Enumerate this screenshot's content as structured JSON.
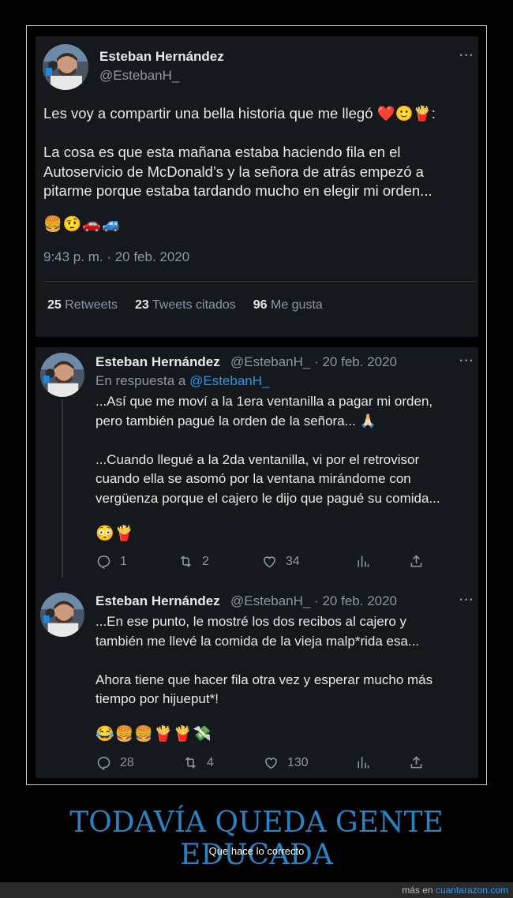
{
  "tweet1": {
    "author_name": "Esteban Hernández",
    "author_handle": "@EstebanH_",
    "more": "···",
    "text": "Les voy a compartir una bella historia que me llegó ❤️🙂🍟:\n\nLa cosa es que esta mañana estaba haciendo fila en el\nAutoservicio de McDonald’s y la señora de atrás empezó a\npitarme porque estaba tardando mucho en elegir mi orden...",
    "emojis": "🍔🤨🚗🚙",
    "timestamp": "9:43 p. m. · 20 feb. 2020",
    "retweets_count": "25",
    "retweets_label": "Retweets",
    "quotes_count": "23",
    "quotes_label": "Tweets citados",
    "likes_count": "96",
    "likes_label": "Me gusta"
  },
  "tweet2": {
    "author_name": "Esteban Hernández",
    "meta": "@EstebanH_ · 20 feb. 2020",
    "more": "···",
    "reply_prefix": "En respuesta a",
    "reply_mention": "@EstebanH_",
    "text": "...Así que me moví a la 1era ventanilla a pagar mi orden,\npero también pagué la orden de la señora... 🙏🏻\n\n...Cuando llegué a la 2da ventanilla, vi por el retrovisor\ncuando ella se asomó por la ventana mirándome con\nvergüenza porque el cajero le dijo que pagué su comida...",
    "emojis": "😳🍟",
    "replies": "1",
    "retweets": "2",
    "likes": "34"
  },
  "tweet3": {
    "author_name": "Esteban Hernández",
    "meta": "@EstebanH_ · 20 feb. 2020",
    "more": "···",
    "text": "...En ese punto, le mostré los dos recibos al cajero y\ntambién me llevé la comida de la vieja malp*rida esa...\n\nAhora tiene que hacer fila otra vez y esperar mucho más\ntiempo por hijueput*!",
    "emojis": "😂🍔🍔🍟🍟💸",
    "replies": "28",
    "retweets": "4",
    "likes": "130"
  },
  "banner": {
    "title": "TODAVÍA QUEDA GENTE EDUCADA",
    "subtitle": "Que hace lo correcto"
  },
  "footer": {
    "prefix": "más en",
    "site": "cuantarazon.com"
  },
  "colors": {
    "card_bg": "#15181c",
    "secondary_text": "#8b98a5",
    "link": "#1d9bf0",
    "banner_title": "#2a84c3"
  },
  "icons": [
    "reply-icon",
    "retweet-icon",
    "like-icon",
    "views-icon",
    "share-icon",
    "more-icon"
  ]
}
